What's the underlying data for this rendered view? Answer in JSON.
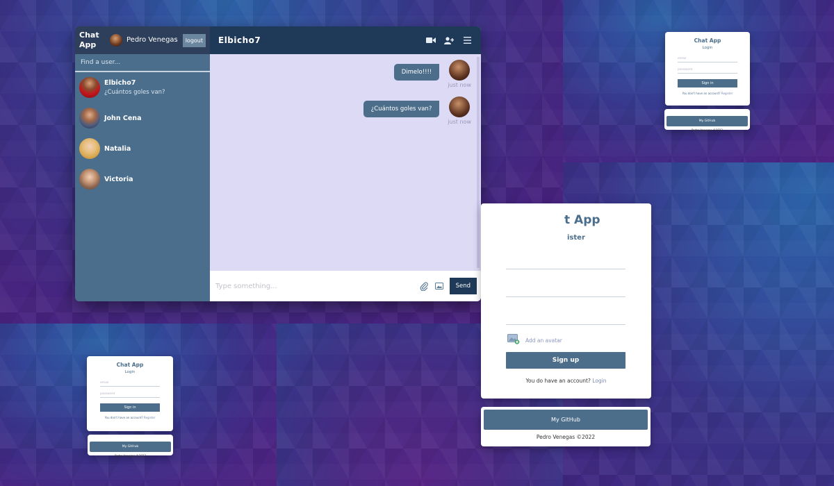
{
  "chat": {
    "brand": "Chat App",
    "current_user": "Pedro Venegas",
    "logout_label": "logout",
    "search_placeholder": "Find a user...",
    "users": [
      {
        "name": "Elbicho7",
        "last_message": "¿Cuántos goles van?"
      },
      {
        "name": "John Cena",
        "last_message": ""
      },
      {
        "name": "Natalia",
        "last_message": ""
      },
      {
        "name": "Victoria",
        "last_message": ""
      }
    ],
    "active_chat": "Elbicho7",
    "messages": [
      {
        "text": "Dimelo!!!!",
        "time": "just now"
      },
      {
        "text": "¿Cuántos goles van?",
        "time": "just now"
      }
    ],
    "input_placeholder": "Type something...",
    "send_label": "Send",
    "header_icons": [
      "video-icon",
      "add-user-icon",
      "menu-icon"
    ]
  },
  "login_small": {
    "title": "Chat App",
    "subtitle": "Login",
    "email_placeholder": "email",
    "password_placeholder": "password",
    "button": "Sign in",
    "note": "You don't have an account?",
    "note_link": "Register",
    "github": "My GitHub",
    "credit": "Pedro Venegas ©2022"
  },
  "register": {
    "title_partial": "t App",
    "subtitle_partial": "ister",
    "avatar_label": "Add an avatar",
    "button": "Sign up",
    "note": "You do have an account?",
    "note_link": "Login",
    "github": "My GitHub",
    "credit": "Pedro Venegas ©2022"
  },
  "colors": {
    "sidebar": "#4a6e8c",
    "header": "#1f3a58",
    "chat_bg": "#dcdaf5",
    "bubble": "#4d6e8a",
    "accent": "#4d6e8a"
  }
}
